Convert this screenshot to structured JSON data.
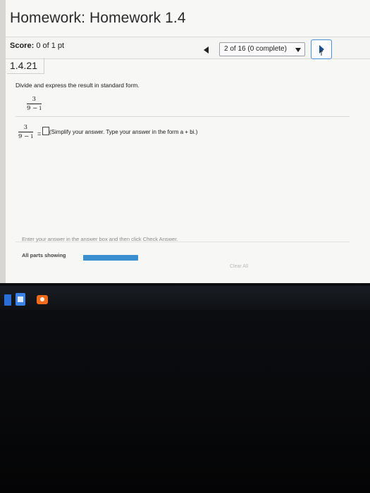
{
  "header": {
    "title": "Homework: Homework 1.4",
    "score_label": "Score:",
    "score_value": "0 of 1 pt"
  },
  "navigation": {
    "progress_text": "2 of 16 (0 complete)",
    "back_icon": "triangle-left-icon",
    "dropdown_icon": "caret-down-icon",
    "next_icon": "next-arrow-icon"
  },
  "question": {
    "number": "1.4.21",
    "prompt": "Divide and express the result in standard form.",
    "fraction_numerator": "3",
    "fraction_denominator": "9 − i",
    "equals_sign": "=",
    "answer_value": "",
    "instruction": "(Simplify your answer. Type your answer in the form a + bi.)"
  },
  "footer": {
    "enter_instruction": "Enter your answer in the answer box and then click Check Answer.",
    "parts_label": "All parts showing",
    "parts_progress": 1.0,
    "clear_all_label": "Clear All"
  },
  "colors": {
    "accent": "#3a8fd1",
    "background": "#f7f7f5"
  },
  "taskbar": {
    "icons": [
      "blue-app-icon",
      "file-explorer-icon",
      "media-app-icon"
    ]
  }
}
